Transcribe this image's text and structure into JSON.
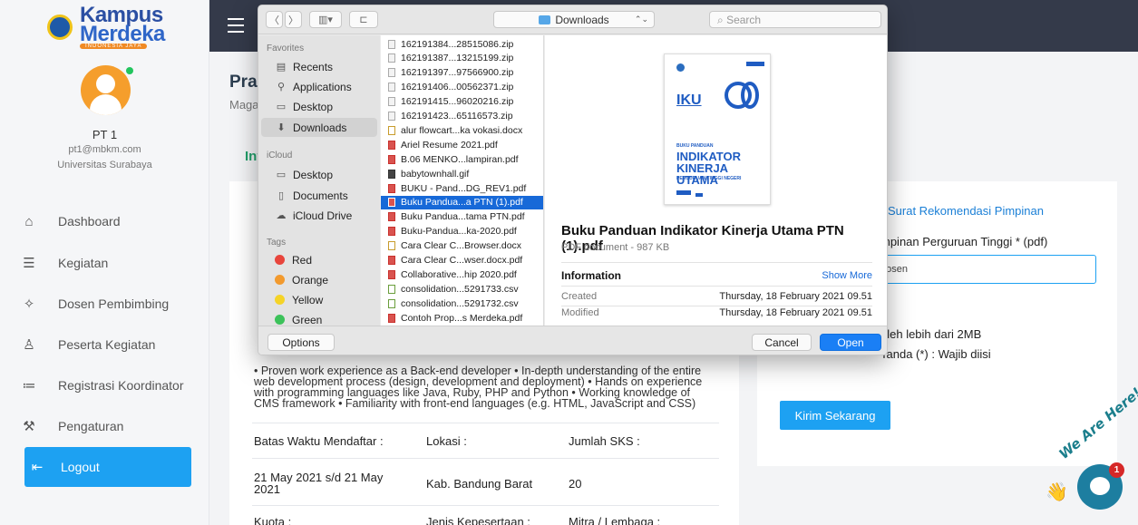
{
  "sidebar": {
    "logo": {
      "line1": "Kampus",
      "line2": "Merdeka",
      "tagline": "INDONESIA JAYA"
    },
    "user": {
      "name": "PT 1",
      "email": "pt1@mbkm.com",
      "university": "Universitas Surabaya"
    },
    "items": [
      {
        "label": "Dashboard",
        "icon": "home-icon",
        "glyph": "⌂"
      },
      {
        "label": "Kegiatan",
        "icon": "message-icon",
        "glyph": "☰"
      },
      {
        "label": "Dosen Pembimbing",
        "icon": "pin-icon",
        "glyph": "✧"
      },
      {
        "label": "Peserta Kegiatan",
        "icon": "user-icon",
        "glyph": "♙"
      },
      {
        "label": "Registrasi Koordinator",
        "icon": "list-icon",
        "glyph": "≔"
      },
      {
        "label": "Pengaturan",
        "icon": "wrench-icon",
        "glyph": "⚒"
      },
      {
        "label": "Logout",
        "icon": "logout-icon",
        "glyph": "⇤"
      }
    ]
  },
  "page": {
    "title": "Pra",
    "subtitle": "Maga",
    "tab": "Inf"
  },
  "main": {
    "description": "• Proven work experience as a Back-end developer • In-depth understanding of the entire web development process (design, development and deployment) • Hands on experience with programming languages like Java, Ruby, PHP and Python • Working knowledge of CMS framework • Familiarity with front-end languages (e.g. HTML, JavaScript and CSS)",
    "headers": {
      "deadline": "Batas Waktu Mendaftar :",
      "location": "Lokasi :",
      "sks": "Jumlah SKS :"
    },
    "values": {
      "deadline": "21 May 2021 s/d 21 May 2021",
      "location": "Kab. Bandung Barat",
      "sks": "20"
    },
    "headers2": {
      "quota": "Kuota :",
      "participation": "Jenis Kepesertaan :",
      "partner": "Mitra / Lembaga :"
    }
  },
  "form": {
    "recommendation_link": "Surat Rekomendasi Pimpinan",
    "file_label": "mpinan Perguruan Tinggi * (pdf)",
    "file_value": "hosen",
    "note_size": "oleh lebih dari 2MB",
    "note_required": "Tanda (*) : Wajib diisi",
    "submit_label": "Kirim Sekarang"
  },
  "chat": {
    "tag": "We Are Here!",
    "badge": "1",
    "wave_glyph": "👋"
  },
  "dialog": {
    "toolbar": {
      "back": "〈",
      "forward": "〉",
      "view": "▥▾",
      "new_folder": "⊏",
      "location": "Downloads",
      "search_placeholder": "Search"
    },
    "sidebar": {
      "favorites_head": "Favorites",
      "favorites": [
        {
          "label": "Recents",
          "glyph": "▤"
        },
        {
          "label": "Applications",
          "glyph": "⚲"
        },
        {
          "label": "Desktop",
          "glyph": "▭"
        },
        {
          "label": "Downloads",
          "glyph": "⬇"
        }
      ],
      "icloud_head": "iCloud",
      "icloud": [
        {
          "label": "Desktop",
          "glyph": "▭"
        },
        {
          "label": "Documents",
          "glyph": "▯"
        },
        {
          "label": "iCloud Drive",
          "glyph": "☁"
        }
      ],
      "tags_head": "Tags",
      "tags": [
        {
          "label": "Red",
          "color": "#e8453c"
        },
        {
          "label": "Orange",
          "color": "#f29a2e"
        },
        {
          "label": "Yellow",
          "color": "#f5d327"
        },
        {
          "label": "Green",
          "color": "#3cc25a"
        }
      ]
    },
    "files": [
      {
        "name": "162191384...28515086.zip",
        "type": "zip"
      },
      {
        "name": "162191387...13215199.zip",
        "type": "zip"
      },
      {
        "name": "162191397...97566900.zip",
        "type": "zip"
      },
      {
        "name": "162191406...00562371.zip",
        "type": "zip"
      },
      {
        "name": "162191415...96020216.zip",
        "type": "zip"
      },
      {
        "name": "162191423...65116573.zip",
        "type": "zip"
      },
      {
        "name": "alur flowcart...ka vokasi.docx",
        "type": "doc"
      },
      {
        "name": "Ariel Resume 2021.pdf",
        "type": "pdf"
      },
      {
        "name": "B.06 MENKO...lampiran.pdf",
        "type": "pdf"
      },
      {
        "name": "babytownhall.gif",
        "type": "gif"
      },
      {
        "name": "BUKU - Pand...DG_REV1.pdf",
        "type": "pdf"
      },
      {
        "name": "Buku Pandua...a PTN (1).pdf",
        "type": "pdf"
      },
      {
        "name": "Buku Pandua...tama PTN.pdf",
        "type": "pdf"
      },
      {
        "name": "Buku-Pandua...ka-2020.pdf",
        "type": "pdf"
      },
      {
        "name": "Cara Clear C...Browser.docx",
        "type": "doc"
      },
      {
        "name": "Cara Clear C...wser.docx.pdf",
        "type": "pdf"
      },
      {
        "name": "Collaborative...hip 2020.pdf",
        "type": "pdf"
      },
      {
        "name": "consolidation...5291733.csv",
        "type": "csv"
      },
      {
        "name": "consolidation...5291732.csv",
        "type": "csv"
      },
      {
        "name": "Contoh Prop...s Merdeka.pdf",
        "type": "pdf"
      }
    ],
    "selected_index": 11,
    "preview": {
      "cover": {
        "logo_text": "IKU",
        "line1": "BUKU PANDUAN",
        "line2a": "INDIKATOR",
        "line2b": "KINERJA UTAMA",
        "line3": "PERGURUAN TINGGI NEGERI"
      },
      "name": "Buku Panduan Indikator Kinerja Utama PTN (1).pdf",
      "kind": "PDF document - 987 KB",
      "info_head": "Information",
      "show_more": "Show More",
      "created_label": "Created",
      "created_value": "Thursday, 18 February 2021 09.51",
      "modified_label": "Modified",
      "modified_value": "Thursday, 18 February 2021 09.51"
    },
    "footer": {
      "options": "Options",
      "cancel": "Cancel",
      "open": "Open"
    }
  }
}
